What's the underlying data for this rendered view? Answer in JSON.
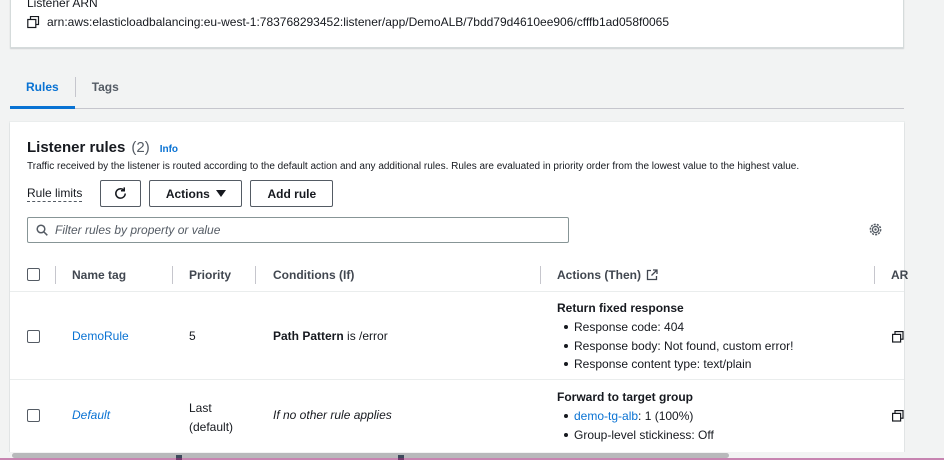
{
  "listener_arn": {
    "heading": "Listener ARN",
    "value": "arn:aws:elasticloadbalancing:eu-west-1:783768293452:listener/app/DemoALB/7bdd79d4610ee906/cfffb1ad058f0065"
  },
  "tabs": [
    {
      "label": "Rules",
      "active": true
    },
    {
      "label": "Tags",
      "active": false
    }
  ],
  "rules": {
    "title": "Listener rules",
    "count": "(2)",
    "info": "Info",
    "description": "Traffic received by the listener is routed according to the default action and any additional rules. Rules are evaluated in priority order from the lowest value to the highest value.",
    "rule_limits": "Rule limits",
    "actions_label": "Actions",
    "add_rule_label": "Add rule",
    "filter_placeholder": "Filter rules by property or value",
    "columns": {
      "name_tag": "Name tag",
      "priority": "Priority",
      "conditions": "Conditions (If)",
      "actions": "Actions (Then)",
      "arn": "AR"
    },
    "rows": [
      {
        "name": "DemoRule",
        "priority": "5",
        "condition_bold": "Path Pattern",
        "condition_rest": "is /error",
        "action_title": "Return fixed response",
        "action_items": [
          "Response code: 404",
          "Response body: Not found, custom error!",
          "Response content type: text/plain"
        ]
      },
      {
        "name": "Default",
        "priority_line1": "Last",
        "priority_line2": "(default)",
        "condition": "If no other rule applies",
        "action_title": "Forward to target group",
        "target_group_link": "demo-tg-alb",
        "target_group_weight": ": 1 (100%)",
        "stickiness": "Group-level stickiness: Off"
      }
    ]
  },
  "colors": {
    "link": "#0972d3",
    "text": "#16191f",
    "border": "#eaeded"
  }
}
